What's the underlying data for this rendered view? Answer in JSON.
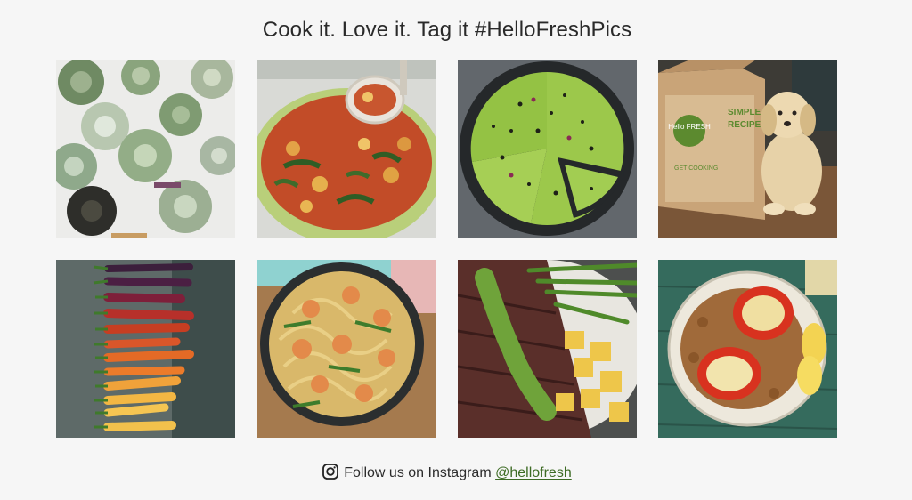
{
  "heading": "Cook it. Love it. Tag it #HelloFreshPics",
  "gallery": {
    "items": [
      {
        "name": "succulent-cupcakes"
      },
      {
        "name": "vegetable-soup-pot"
      },
      {
        "name": "avocado-flatbread"
      },
      {
        "name": "puppy-with-box",
        "box_brand": "Hello FRESH",
        "box_text_1": "SIMPLE",
        "box_text_2": "RECIPES",
        "box_text_3": "GET COOKING"
      },
      {
        "name": "rainbow-carrots"
      },
      {
        "name": "shrimp-noodles"
      },
      {
        "name": "steak-potatoes"
      },
      {
        "name": "stuffed-peppers"
      }
    ]
  },
  "footer": {
    "icon": "instagram-icon",
    "text": "Follow us on Instagram",
    "handle": "@hellofresh"
  },
  "colors": {
    "background": "#f6f6f6",
    "link": "#3d6b24",
    "text": "#2b2b2b"
  }
}
